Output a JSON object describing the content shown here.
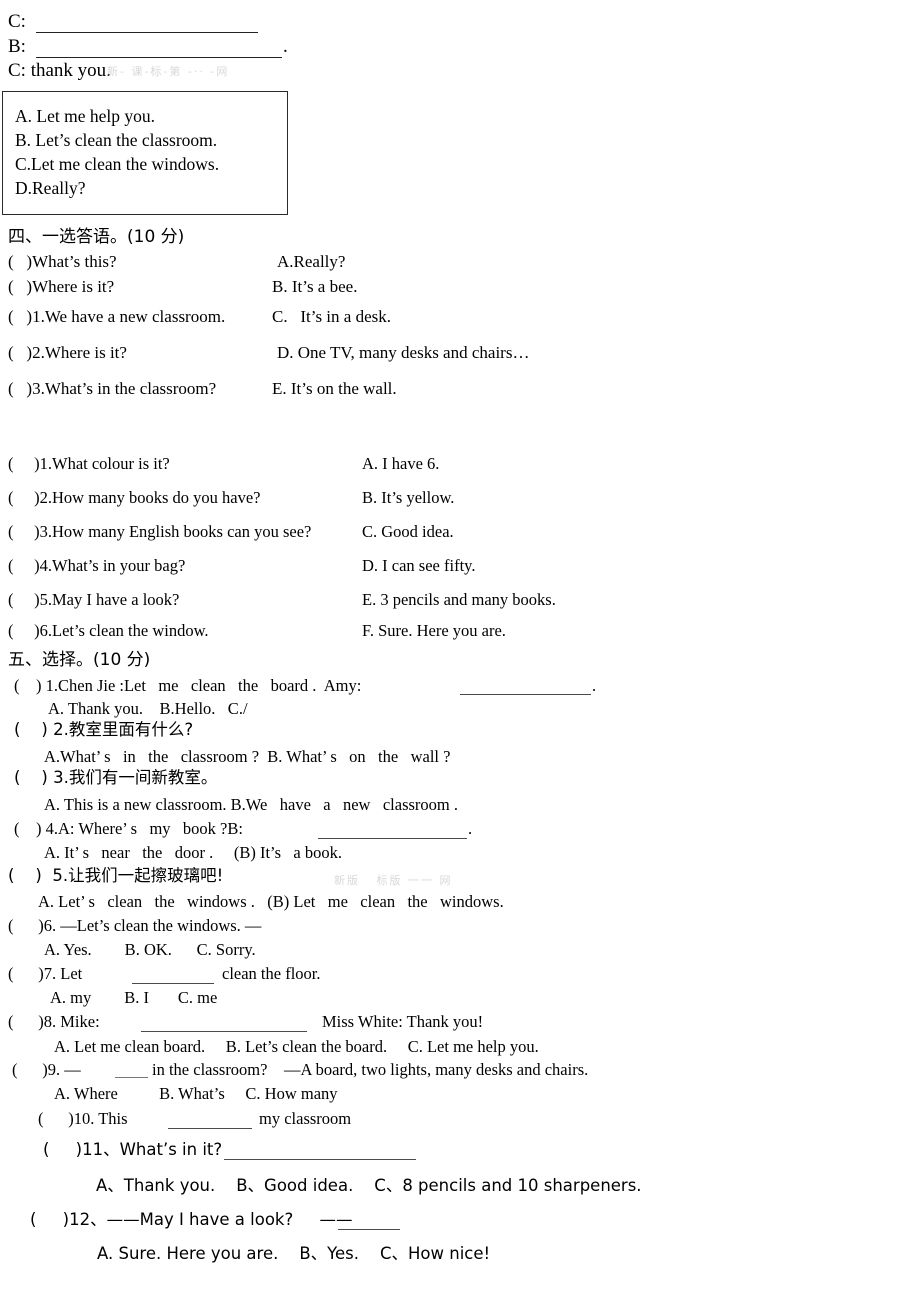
{
  "document": {
    "title": "English Exam Worksheet - Sections IV and V",
    "language": "en-zh"
  },
  "dialogue": {
    "line_c_label": "C:",
    "line_b_label": "B:",
    "line_b_period": ".",
    "line_c_thanks": "C: thank you.",
    "watermark_1": "新- 课-标-第 -·· -网"
  },
  "option_box": {
    "items": [
      "A. Let me help you.",
      "B. Let’s clean the classroom.",
      "C.Let me clean the windows.",
      "D.Really?"
    ]
  },
  "section_four": {
    "heading": "四、一选答语。(10 分)",
    "left": [
      "(   )What’s this?",
      "(   )Where is it?",
      "(   )1.We have a new classroom.",
      "(   )2.Where is it?",
      "(   )3.What’s in the classroom?"
    ],
    "right": [
      "A.Really?",
      "B. It’s a bee.",
      "C.   It’s in a desk.",
      "D. One TV, many desks and chairs…",
      "E. It’s on the wall."
    ]
  },
  "section_four_b": {
    "left": [
      "(     )1.What colour is it?",
      "(     )2.How many books do you have?",
      "(     )3.How many English books can you see?",
      "(     )4.What’s in your bag?",
      "(     )5.May I have a look?",
      "(     )6.Let’s clean the window."
    ],
    "right": [
      "A. I have 6.",
      "B. It’s yellow.",
      "C. Good idea.",
      "D. I can see fifty.",
      "E. 3 pencils and many books.",
      "F. Sure. Here you are."
    ]
  },
  "section_five": {
    "heading": "五、选择。(10 分)",
    "watermark_2": "新版   标版 一一 网",
    "q1_stem": "(    ) 1.Chen Jie :Let   me   clean   the   board .  Amy: ",
    "q1_period": ".",
    "q1_options": "A. Thank you.    B.Hello.   C./",
    "q2_stem": "(    ) 2.教室里面有什么?",
    "q2_options": "A.What’ s   in   the   classroom ?  B. What’ s   on   the   wall ?",
    "q3_stem": "(    ) 3.我们有一间新教室。",
    "q3_options": "A. This is a new classroom. B.We   have   a   new   classroom .",
    "q4_stem": "(    ) 4.A: Where’ s   my   book ?B:",
    "q4_period": ".",
    "q4_options": "A. It’ s   near   the   door .     (B) It’s   a book.",
    "q5_stem": "(    )  5.让我们一起擦玻璃吧!",
    "q5_options": "A. Let’ s   clean   the   windows .   (B) Let   me   clean   the   windows.",
    "q6_stem": "(      )6. —Let’s clean the windows. —",
    "q6_options": "A. Yes.        B. OK.      C. Sorry.",
    "q7_stem_a": "(      )7. Let",
    "q7_stem_b": "clean the floor.",
    "q7_options": "A. my        B. I       C. me",
    "q8_stem_a": "(      )8. Mike:",
    "q8_stem_b": "Miss White: Thank you!",
    "q8_options": "A. Let me clean board.     B. Let’s clean the board.     C. Let me help you.",
    "q9_stem_a": "(      )9. —",
    "q9_stem_b": "in the classroom?    —A board, two lights, many desks and chairs.",
    "q9_options": "A. Where          B. What’s     C. How many",
    "q10_stem_a": "(      )10. This",
    "q10_stem_b": "my classroom",
    "q11_stem": "(     )11、What’s in it?",
    "q11_options": "A、Thank you.    B、Good idea.    C、8 pencils and 10 sharpeners.",
    "q12_stem_a": "(     )12、——May I have a look?     ——",
    "q12_options": "A. Sure. Here you are.    B、Yes.    C、How nice!"
  }
}
